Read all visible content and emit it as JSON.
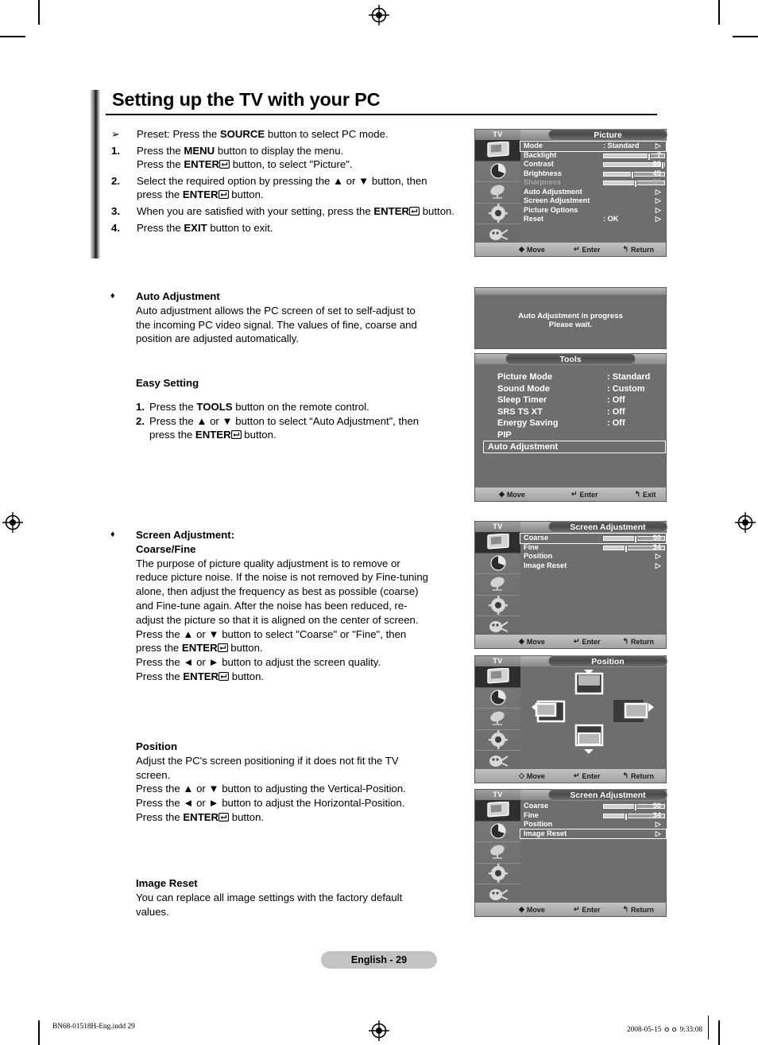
{
  "page_title": "Setting up the TV with your PC",
  "steps": [
    {
      "num": "➢",
      "parts": [
        {
          "t": "Preset: Press the "
        },
        {
          "t": "SOURCE",
          "b": true
        },
        {
          "t": " button to select PC mode."
        }
      ]
    },
    {
      "num": "1.",
      "parts": [
        {
          "t": "Press the "
        },
        {
          "t": "MENU",
          "b": true
        },
        {
          "t": " button to display the menu."
        },
        {
          "br": true
        },
        {
          "t": "Press the "
        },
        {
          "t": "ENTER",
          "b": true
        },
        {
          "enter": true
        },
        {
          "t": " button, to select \"Picture\"."
        }
      ]
    },
    {
      "num": "2.",
      "parts": [
        {
          "t": "Select the required option by pressing the ▲ or ▼ button, then press the "
        },
        {
          "t": "ENTER",
          "b": true
        },
        {
          "enter": true
        },
        {
          "t": " button."
        }
      ]
    },
    {
      "num": "3.",
      "parts": [
        {
          "t": "When you are satisfied with your setting, press the "
        },
        {
          "t": "ENTER",
          "b": true
        },
        {
          "enter": true
        },
        {
          "t": " button."
        }
      ]
    },
    {
      "num": "4.",
      "parts": [
        {
          "t": "Press the "
        },
        {
          "t": "EXIT",
          "b": true
        },
        {
          "t": " button to exit."
        }
      ]
    }
  ],
  "sections": {
    "auto_adjustment": {
      "bullet": "♦",
      "heading": "Auto Adjustment",
      "body": "Auto adjustment allows the PC screen of set to self-adjust to the incoming PC video signal. The values of fine, coarse and position are adjusted automatically."
    },
    "easy_setting": {
      "heading": "Easy Setting",
      "items": [
        {
          "n": "1.",
          "parts": [
            {
              "t": "Press the "
            },
            {
              "t": "TOOLS",
              "b": true
            },
            {
              "t": " button on the remote control."
            }
          ]
        },
        {
          "n": "2.",
          "parts": [
            {
              "t": "Press the ▲ or ▼ button to select “Auto Adjustment”, then press the "
            },
            {
              "t": "ENTER",
              "b": true
            },
            {
              "enter": true
            },
            {
              "t": " button."
            }
          ]
        }
      ]
    },
    "screen_adjustment": {
      "bullet": "♦",
      "heading_line1": "Screen Adjustment:",
      "heading_line2": "Coarse/Fine",
      "body": "The purpose of picture quality adjustment is to remove or reduce picture noise. If the noise is not removed by Fine-tuning alone, then adjust the frequency as best as possible (coarse) and Fine-tune again. After the noise has been reduced, re-adjust the picture so that it is aligned on the center of screen.",
      "lines": [
        [
          {
            "t": "Press the ▲ or ▼ button to select \"Coarse\" or \"Fine\", then press the "
          },
          {
            "t": "ENTER",
            "b": true
          },
          {
            "enter": true
          },
          {
            "t": " button."
          }
        ],
        [
          {
            "t": "Press the ◄ or ► button to adjust the screen quality."
          }
        ],
        [
          {
            "t": "Press the "
          },
          {
            "t": "ENTER",
            "b": true
          },
          {
            "enter": true
          },
          {
            "t": " button."
          }
        ]
      ]
    },
    "position": {
      "heading": "Position",
      "body": "Adjust the PC's screen positioning if it does not fit the TV screen.",
      "lines": [
        [
          {
            "t": "Press the ▲ or ▼ button to adjusting the Vertical-Position."
          }
        ],
        [
          {
            "t": "Press the ◄ or ► button to adjust the Horizontal-Position."
          }
        ],
        [
          {
            "t": "Press the "
          },
          {
            "t": "ENTER",
            "b": true
          },
          {
            "enter": true
          },
          {
            "t": " button."
          }
        ]
      ]
    },
    "image_reset": {
      "heading": "Image Reset",
      "body": "You can replace all image settings with the factory default values."
    }
  },
  "osd": {
    "tv_label": "TV",
    "hints": {
      "move": "Move",
      "enter": "Enter",
      "return": "Return",
      "exit": "Exit"
    },
    "picture_menu": {
      "title": "Picture",
      "rows": [
        {
          "label": "Mode",
          "value": ": Standard",
          "type": "value",
          "arrow": true,
          "selected": true
        },
        {
          "label": "Backlight",
          "type": "slider",
          "fill": 72,
          "number": "7"
        },
        {
          "label": "Contrast",
          "type": "slider",
          "fill": 95,
          "number": "95"
        },
        {
          "label": "Brightness",
          "type": "slider",
          "fill": 45,
          "number": "45"
        },
        {
          "label": "Sharpness",
          "type": "slider",
          "fill": 50,
          "number": "50",
          "dim": true
        },
        {
          "label": "Auto Adjustment",
          "type": "arrow"
        },
        {
          "label": "Screen Adjustment",
          "type": "arrow"
        },
        {
          "label": "Picture Options",
          "type": "arrow"
        },
        {
          "label": "Reset",
          "value": ": OK",
          "type": "value",
          "arrow": true
        }
      ]
    },
    "auto_adjust_progress": {
      "line1": "Auto Adjustment in progress",
      "line2": "Please wait."
    },
    "tools_menu": {
      "title": "Tools",
      "rows": [
        {
          "label": "Picture Mode",
          "value": ": Standard"
        },
        {
          "label": "Sound Mode",
          "value": ": Custom"
        },
        {
          "label": "Sleep Timer",
          "value": ": Off"
        },
        {
          "label": "SRS TS XT",
          "value": ": Off"
        },
        {
          "label": "Energy Saving",
          "value": ": Off"
        },
        {
          "label": "PIP",
          "value": ""
        },
        {
          "label": "Auto Adjustment",
          "value": "",
          "selected": true
        }
      ]
    },
    "screen_adjustment_menu": {
      "title": "Screen Adjustment",
      "rows": [
        {
          "label": "Coarse",
          "type": "slider",
          "fill": 50,
          "number": "50",
          "selected": true
        },
        {
          "label": "Fine",
          "type": "slider",
          "fill": 34,
          "number": "34"
        },
        {
          "label": "Position",
          "type": "arrow"
        },
        {
          "label": "Image Reset",
          "type": "arrow"
        }
      ]
    },
    "position_menu": {
      "title": "Position"
    },
    "screen_adjustment_menu2": {
      "title": "Screen Adjustment",
      "rows": [
        {
          "label": "Coarse",
          "type": "slider",
          "fill": 50,
          "number": "50"
        },
        {
          "label": "Fine",
          "type": "slider",
          "fill": 34,
          "number": "34"
        },
        {
          "label": "Position",
          "type": "arrow"
        },
        {
          "label": "Image Reset",
          "type": "arrow",
          "selected": true
        }
      ]
    }
  },
  "page_number_badge": "English - 29",
  "footer": {
    "left": "BN68-01518H-Eng.indd   29",
    "right": "2008-05-15   ｏｏ 9:33:08"
  }
}
